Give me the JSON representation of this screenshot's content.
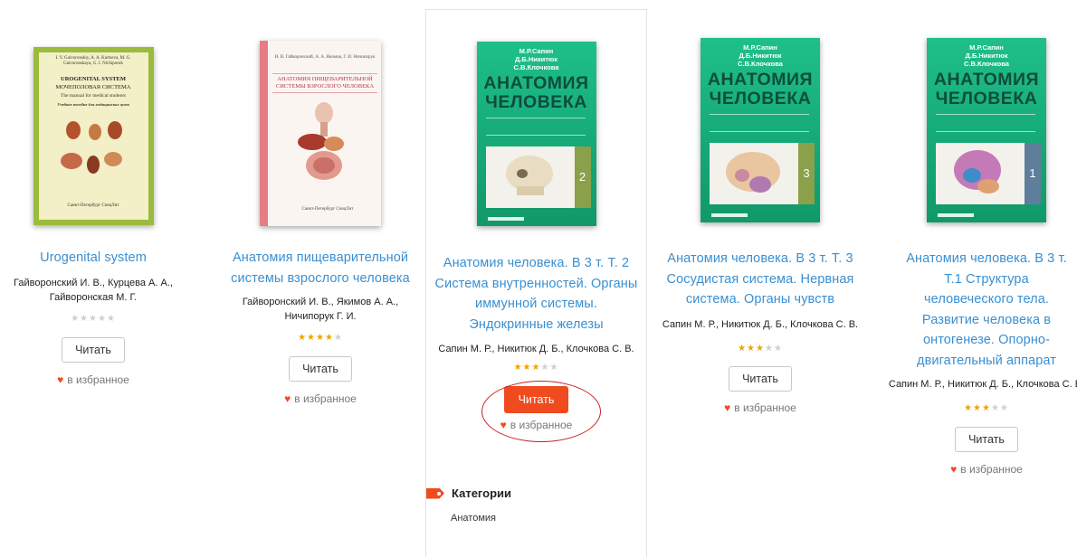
{
  "books": [
    {
      "title": "Urogenital system",
      "authors": "Гайворонский И. В., Курцева А. А., Гайворонская М. Г.",
      "rating": 0,
      "read_label": "Читать",
      "fav_label": "в избранное",
      "cover": {
        "line1": "I. V. Gaivoronskiy, A. A. Kurtseva, M. G. Gaivoronskaya, G. I. Nichiporuk",
        "line2": "UROGENITAL SYSTEM",
        "line3": "МОЧЕПОЛОВАЯ СИСТЕМА",
        "line4": "The manual for medical students",
        "line5": "Учебное пособие для медицинских вузов",
        "line6": "Санкт-Петербург СпецЛит"
      }
    },
    {
      "title": "Анатомия пищеварительной системы взрослого человека",
      "authors": "Гайворонский И. В., Якимов А. А., Ничипорук Г. И.",
      "rating": 4,
      "read_label": "Читать",
      "fav_label": "в избранное",
      "cover": {
        "line1": "И. В. Гайворонский, А. А. Якимов, Г. И. Ничипорук",
        "line2": "АНАТОМИЯ ПИЩЕВАРИТЕЛЬНОЙ СИСТЕМЫ ВЗРОСЛОГО ЧЕЛОВЕКА",
        "line3": "Санкт-Петербург СпецЛит"
      }
    },
    {
      "title": "Анатомия человека. В 3 т. Т. 2 Система внутренностей. Органы иммунной системы. Эндокринные железы",
      "authors": "Сапин М. Р., Никитюк Д. Б., Клочкова С. В.",
      "rating": 3,
      "read_label": "Читать",
      "fav_label": "в избранное",
      "cover": {
        "authors": "М.Р.Сапин Д.Б.Никитюк С.В.Клочкова",
        "title": "АНАТОМИЯ ЧЕЛОВЕКА",
        "volume": "2"
      }
    },
    {
      "title": "Анатомия человека. В 3 т. Т. 3 Сосудистая система. Нервная система. Органы чувств",
      "authors": "Сапин М. Р., Никитюк Д. Б., Клочкова С. В.",
      "rating": 3,
      "read_label": "Читать",
      "fav_label": "в избранное",
      "cover": {
        "authors": "М.Р.Сапин Д.Б.Никитюк С.В.Клочкова",
        "title": "АНАТОМИЯ ЧЕЛОВЕКА",
        "volume": "3"
      }
    },
    {
      "title": "Анатомия человека. В 3 т. Т.1 Структура человеческого тела. Развитие человека в онтогенезе. Опорно-двигательный аппарат",
      "authors": "Сапин М. Р., Никитюк Д. Б., Клочкова С. В.",
      "rating": 3,
      "read_label": "Читать",
      "fav_label": "в избранное",
      "cover": {
        "authors": "М.Р.Сапин Д.Б.Никитюк С.В.Клочкова",
        "title": "АНАТОМИЯ ЧЕЛОВЕКА",
        "volume": "1"
      }
    }
  ],
  "categories": {
    "heading": "Категории",
    "items": [
      "Анатомия"
    ]
  },
  "colors": {
    "link": "#3a8fd1",
    "accent": "#f04b1f",
    "star_on": "#f0a300",
    "highlight_circle": "#c91f1f"
  }
}
